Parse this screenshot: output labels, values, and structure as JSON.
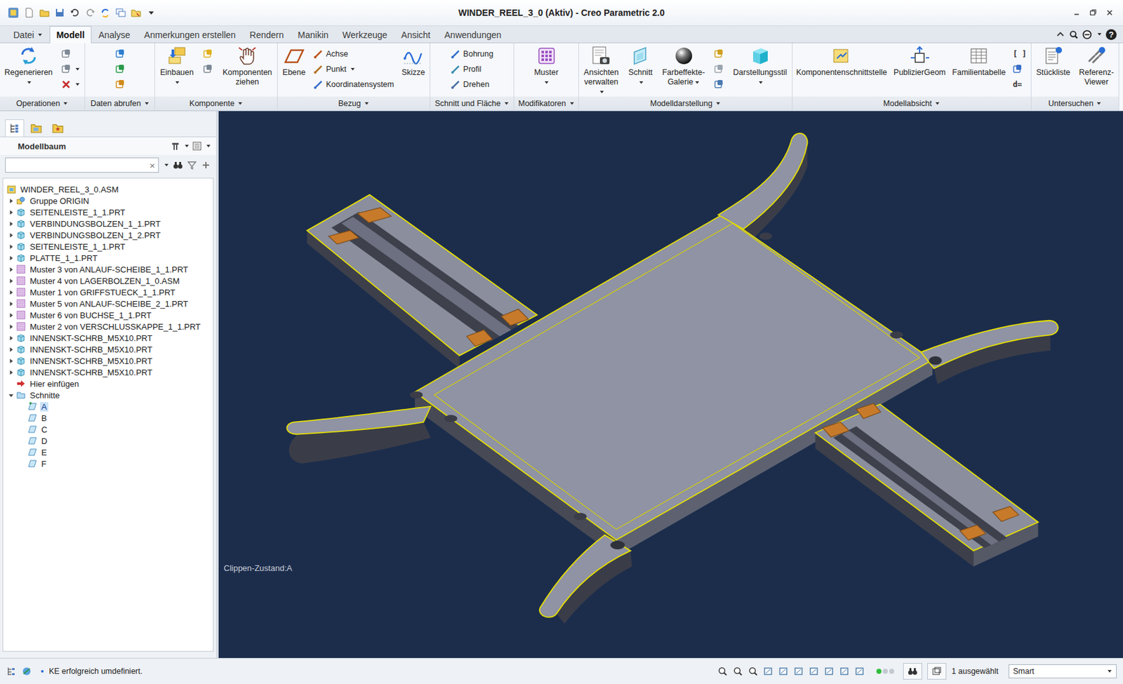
{
  "window": {
    "title": "WINDER_REEL_3_0 (Aktiv) - Creo Parametric 2.0"
  },
  "tabs": [
    {
      "label": "Datei",
      "selected": false,
      "menu": true
    },
    {
      "label": "Modell",
      "selected": true,
      "menu": false
    },
    {
      "label": "Analyse",
      "selected": false,
      "menu": false
    },
    {
      "label": "Anmerkungen erstellen",
      "selected": false,
      "menu": false
    },
    {
      "label": "Rendern",
      "selected": false,
      "menu": false
    },
    {
      "label": "Manikin",
      "selected": false,
      "menu": false
    },
    {
      "label": "Werkzeuge",
      "selected": false,
      "menu": false
    },
    {
      "label": "Ansicht",
      "selected": false,
      "menu": false
    },
    {
      "label": "Anwendungen",
      "selected": false,
      "menu": false
    }
  ],
  "help": "?",
  "ribbon": [
    {
      "label": "Operationen",
      "menu": true,
      "columns": [
        [
          {
            "kind": "large",
            "label": "Regenerieren",
            "menu": true
          }
        ],
        [
          {
            "kind": "icon",
            "menu": false
          },
          {
            "kind": "icon",
            "menu": true
          },
          {
            "kind": "icon",
            "menu": true
          }
        ]
      ]
    },
    {
      "label": "Daten abrufen",
      "menu": true,
      "columns": [
        [
          {
            "kind": "icon",
            "menu": false
          },
          {
            "kind": "icon",
            "menu": false
          },
          {
            "kind": "icon",
            "menu": false
          }
        ]
      ]
    },
    {
      "label": "Komponente",
      "menu": true,
      "columns": [
        [
          {
            "kind": "large",
            "label": "Einbauen",
            "menu": true
          }
        ],
        [
          {
            "kind": "icon",
            "menu": false
          },
          {
            "kind": "icon",
            "menu": false
          }
        ],
        [
          {
            "kind": "large",
            "label": "Komponenten ziehen",
            "menu": false
          }
        ]
      ]
    },
    {
      "label": "Bezug",
      "menu": true,
      "columns": [
        [
          {
            "kind": "large",
            "label": "Ebene",
            "menu": false
          }
        ],
        [
          {
            "kind": "small",
            "label": "Achse",
            "menu": false
          },
          {
            "kind": "small",
            "label": "Punkt",
            "menu": true
          },
          {
            "kind": "small",
            "label": "Koordinatensystem",
            "menu": false
          }
        ],
        [
          {
            "kind": "large",
            "label": "Skizze",
            "menu": false
          }
        ]
      ]
    },
    {
      "label": "Schnitt und Fläche",
      "menu": true,
      "columns": [
        [
          {
            "kind": "small",
            "label": "Bohrung",
            "menu": false
          },
          {
            "kind": "small",
            "label": "Profil",
            "menu": false
          },
          {
            "kind": "small",
            "label": "Drehen",
            "menu": false
          }
        ]
      ]
    },
    {
      "label": "Modifikatoren",
      "menu": true,
      "columns": [
        [
          {
            "kind": "large",
            "label": "Muster",
            "menu": true
          }
        ]
      ]
    },
    {
      "label": "Modelldarstellung",
      "menu": true,
      "columns": [
        [
          {
            "kind": "large",
            "label": "Ansichten verwalten",
            "menu": true
          }
        ],
        [
          {
            "kind": "large",
            "label": "Schnitt",
            "menu": true
          }
        ],
        [
          {
            "kind": "large",
            "label": "Farbeffekte-Galerie",
            "menu": true
          }
        ],
        [
          {
            "kind": "icon",
            "menu": false
          },
          {
            "kind": "icon",
            "menu": false
          },
          {
            "kind": "icon",
            "menu": false
          }
        ],
        [
          {
            "kind": "large",
            "label": "Darstellungsstil",
            "menu": true
          }
        ]
      ]
    },
    {
      "label": "Modellabsicht",
      "menu": true,
      "columns": [
        [
          {
            "kind": "large",
            "label": "Komponentenschnittstelle",
            "menu": false
          }
        ],
        [
          {
            "kind": "large",
            "label": "PublizierGeom",
            "menu": false
          }
        ],
        [
          {
            "kind": "large",
            "label": "Familientabelle",
            "menu": false
          }
        ],
        [
          {
            "kind": "glyph",
            "label": "[ ]",
            "menu": false
          },
          {
            "kind": "icon",
            "menu": false
          },
          {
            "kind": "glyph",
            "label": "d=",
            "menu": false
          }
        ]
      ]
    },
    {
      "label": "Untersuchen",
      "menu": true,
      "columns": [
        [
          {
            "kind": "large",
            "label": "Stückliste",
            "menu": false
          }
        ],
        [
          {
            "kind": "large",
            "label": "Referenz-Viewer",
            "menu": false
          }
        ]
      ]
    }
  ],
  "model_tree": {
    "title": "Modellbaum",
    "search": {
      "value": "",
      "clear": "×"
    },
    "items": [
      {
        "label": "WINDER_REEL_3_0.ASM",
        "kind": "assembly",
        "depth": 0,
        "expandable": false,
        "expanded": true,
        "selected": false
      },
      {
        "label": "Gruppe ORIGIN",
        "kind": "group",
        "depth": 1,
        "expandable": true,
        "expanded": false,
        "selected": false
      },
      {
        "label": "SEITENLEISTE_1_1.PRT",
        "kind": "part",
        "depth": 1,
        "expandable": true,
        "expanded": false,
        "selected": false
      },
      {
        "label": "VERBINDUNGSBOLZEN_1_1.PRT",
        "kind": "part",
        "depth": 1,
        "expandable": true,
        "expanded": false,
        "selected": false
      },
      {
        "label": "VERBINDUNGSBOLZEN_1_2.PRT",
        "kind": "part",
        "depth": 1,
        "expandable": true,
        "expanded": false,
        "selected": false
      },
      {
        "label": "SEITENLEISTE_1_1.PRT",
        "kind": "part",
        "depth": 1,
        "expandable": true,
        "expanded": false,
        "selected": false
      },
      {
        "label": "PLATTE_1_1.PRT",
        "kind": "part",
        "depth": 1,
        "expandable": true,
        "expanded": false,
        "selected": false
      },
      {
        "label": "Muster 3 von ANLAUF-SCHEIBE_1_1.PRT",
        "kind": "pattern",
        "depth": 1,
        "expandable": true,
        "expanded": false,
        "selected": false
      },
      {
        "label": "Muster 4 von LAGERBOLZEN_1_0.ASM",
        "kind": "pattern",
        "depth": 1,
        "expandable": true,
        "expanded": false,
        "selected": false
      },
      {
        "label": "Muster 1 von GRIFFSTUECK_1_1.PRT",
        "kind": "pattern",
        "depth": 1,
        "expandable": true,
        "expanded": false,
        "selected": false
      },
      {
        "label": "Muster 5 von ANLAUF-SCHEIBE_2_1.PRT",
        "kind": "pattern",
        "depth": 1,
        "expandable": true,
        "expanded": false,
        "selected": false
      },
      {
        "label": "Muster 6 von BUCHSE_1_1.PRT",
        "kind": "pattern",
        "depth": 1,
        "expandable": true,
        "expanded": false,
        "selected": false
      },
      {
        "label": "Muster 2 von VERSCHLUSSKAPPE_1_1.PRT",
        "kind": "pattern",
        "depth": 1,
        "expandable": true,
        "expanded": false,
        "selected": false
      },
      {
        "label": "INNENSKT-SCHRB_M5X10.PRT",
        "kind": "part",
        "depth": 1,
        "expandable": true,
        "expanded": false,
        "selected": false
      },
      {
        "label": "INNENSKT-SCHRB_M5X10.PRT",
        "kind": "part",
        "depth": 1,
        "expandable": true,
        "expanded": false,
        "selected": false
      },
      {
        "label": "INNENSKT-SCHRB_M5X10.PRT",
        "kind": "part",
        "depth": 1,
        "expandable": true,
        "expanded": false,
        "selected": false
      },
      {
        "label": "INNENSKT-SCHRB_M5X10.PRT",
        "kind": "part",
        "depth": 1,
        "expandable": true,
        "expanded": false,
        "selected": false
      },
      {
        "label": "Hier einfügen",
        "kind": "insert",
        "depth": 1,
        "expandable": false,
        "expanded": false,
        "selected": false
      },
      {
        "label": "Schnitte",
        "kind": "folder",
        "depth": 1,
        "expandable": true,
        "expanded": true,
        "selected": false
      },
      {
        "label": "A",
        "kind": "section",
        "depth": 2,
        "expandable": false,
        "expanded": false,
        "selected": true
      },
      {
        "label": "B",
        "kind": "section",
        "depth": 2,
        "expandable": false,
        "expanded": false,
        "selected": false
      },
      {
        "label": "C",
        "kind": "section",
        "depth": 2,
        "expandable": false,
        "expanded": false,
        "selected": false
      },
      {
        "label": "D",
        "kind": "section",
        "depth": 2,
        "expandable": false,
        "expanded": false,
        "selected": false
      },
      {
        "label": "E",
        "kind": "section",
        "depth": 2,
        "expandable": false,
        "expanded": false,
        "selected": false
      },
      {
        "label": "F",
        "kind": "section",
        "depth": 2,
        "expandable": false,
        "expanded": false,
        "selected": false
      }
    ]
  },
  "viewport": {
    "clip_label": "Clippen-Zustand:A"
  },
  "status_bar": {
    "bullet": "•",
    "message": "KE erfolgreich umdefiniert.",
    "lights": [
      {
        "on": true
      },
      {
        "on": false
      },
      {
        "on": false
      }
    ],
    "selection": "1 ausgewählt",
    "filter": "Smart"
  }
}
